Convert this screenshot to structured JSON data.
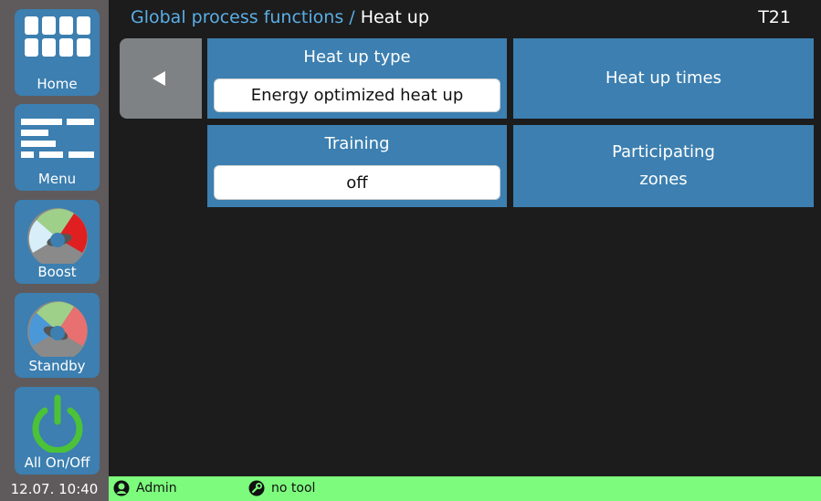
{
  "header": {
    "breadcrumb_parent": "Global process functions /",
    "breadcrumb_current": "Heat up",
    "code": "T21"
  },
  "sidebar": {
    "items": [
      {
        "label": "Home",
        "icon": "grid-icon"
      },
      {
        "label": "Menu",
        "icon": "menu-icon"
      },
      {
        "label": "Boost",
        "icon": "boost-gauge-icon"
      },
      {
        "label": "Standby",
        "icon": "standby-gauge-icon"
      },
      {
        "label": "All On/Off",
        "icon": "power-icon"
      }
    ]
  },
  "tiles": {
    "heat_up_type": {
      "title": "Heat up type",
      "value": "Energy optimized heat up"
    },
    "heat_up_times": {
      "title": "Heat up times"
    },
    "training": {
      "title": "Training",
      "value": "off"
    },
    "participating_zones": {
      "line1": "Participating",
      "line2": "zones"
    }
  },
  "status": {
    "datetime": "12.07. 10:40",
    "user": "Admin",
    "tool": "no tool"
  },
  "colors": {
    "tile_blue": "#3c7fb0",
    "sidebar_gray": "#5f5a5c",
    "status_green": "#7dfb7d",
    "breadcrumb_blue": "#5aaee6"
  }
}
